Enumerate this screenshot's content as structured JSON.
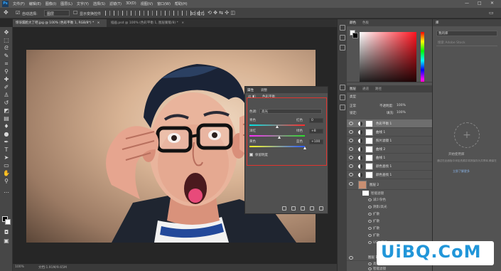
{
  "app": {
    "logo": "Ps"
  },
  "menubar": {
    "items": [
      "文件(F)",
      "编辑(E)",
      "图像(I)",
      "图层(L)",
      "文字(Y)",
      "选择(S)",
      "滤镜(T)",
      "3D(D)",
      "视图(V)",
      "窗口(W)",
      "帮助(H)"
    ],
    "window_controls": [
      "—",
      "□",
      "✕"
    ]
  },
  "options_bar": {
    "auto_select_label": "自动选择:",
    "auto_select_value": "图层",
    "show_transform_label": "显示变换控件",
    "mode_label": "3D 模式:"
  },
  "doc_tabs": [
    {
      "label": "惊讶漏脸大了吧.jpg @ 100% (色彩平衡 1, RGB/8*) *",
      "close": "×"
    },
    {
      "label": "插画.psd @ 100% (色彩平衡 1, 图层蒙版/8) *",
      "close": "×"
    }
  ],
  "status_bar": {
    "zoom": "100%",
    "doc_info": "文档:1.91M/9.65M"
  },
  "color_panel": {
    "tabs": [
      "颜色",
      "色板"
    ]
  },
  "layers_panel": {
    "tabs": [
      "图层",
      "通道",
      "路径"
    ],
    "kind_label": "类型",
    "blend_mode": "正常",
    "opacity_label": "不透明度:",
    "opacity_value": "100%",
    "lock_label": "锁定:",
    "fill_label": "填充:",
    "fill_value": "100%",
    "layers": [
      "色彩平衡 1",
      "曲线 1",
      "照片滤镜 1",
      "曲线 2",
      "曲线 1",
      "颜色查找 1",
      "颜色查找 1"
    ],
    "layer2_name": "图层 2",
    "smart_filters": "智能滤镜",
    "filter_items": [
      "减少杂色",
      "阴影/高光",
      "扩散",
      "扩散",
      "扩散",
      "扩散",
      "USM 锐化"
    ],
    "group_name": "图层 1 拷贝",
    "bottom_layer_items": [
      "高反差保留",
      "智能滤镜"
    ]
  },
  "libraries_panel": {
    "header": "库",
    "dropdown": "我的库",
    "search_placeholder": "搜索 Adobe Stock",
    "empty_title": "开始使用库",
    "empty_text": "通过在此面板中添加资源并将其保存为共享库,确保在 ",
    "learn_more": "立即了解更多"
  },
  "properties_panel": {
    "tabs": [
      "属性",
      "调整"
    ],
    "title": "色彩平衡",
    "tone_label": "色调:",
    "tone_value": "高光",
    "sliders": [
      {
        "left": "青色",
        "right": "红色",
        "value": "0"
      },
      {
        "left": "洋红",
        "right": "绿色",
        "value": "+8"
      },
      {
        "left": "黄色",
        "right": "蓝色",
        "value": "+100"
      }
    ],
    "slider_positions": [
      0.5,
      0.54,
      1.0
    ],
    "preserve_luminosity": "保留明度"
  },
  "watermark": {
    "text": "UiBQ.CoM"
  },
  "colors": {
    "accent": "#31a8ff",
    "highlight_border": "#e0352f",
    "watermark": "#2196d9"
  }
}
